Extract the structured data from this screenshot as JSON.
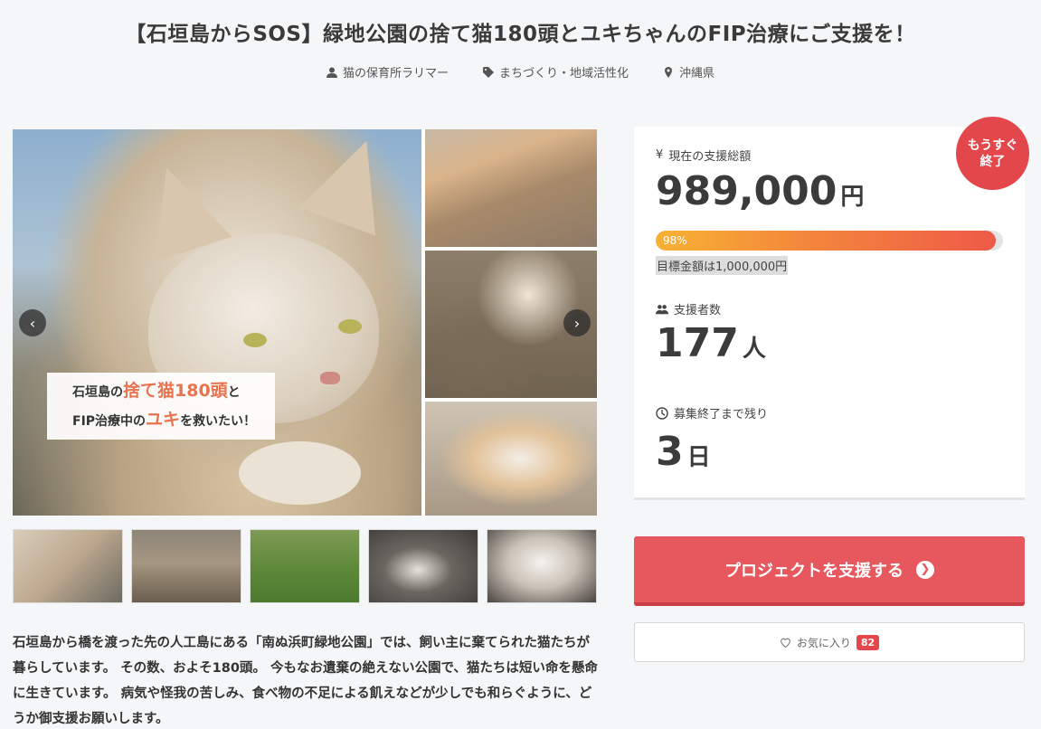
{
  "header": {
    "title": "【石垣島からSOS】緑地公園の捨て猫180頭とユキちゃんのFIP治療にご支援を！",
    "owner": "猫の保育所ラリマー",
    "category": "まちづくり・地域活性化",
    "location": "沖縄県"
  },
  "gallery": {
    "caption_line1_pre": "石垣島の",
    "caption_line1_hl": "捨て猫180頭",
    "caption_line1_post": "と",
    "caption_line2_pre": "FIP治療中の",
    "caption_line2_hl": "ユキ",
    "caption_line2_post": "を救いたい！",
    "thumbnail_count": 5
  },
  "description": "石垣島から橋を渡った先の人工島にある「南ぬ浜町緑地公園」では、飼い主に棄てられた猫たちが暮らしています。 その数、およそ180頭。 今もなお遺棄の絶えない公園で、猫たちは短い命を懸命に生きています。 病気や怪我の苦しみ、食べ物の不足による飢えなどが少しでも和らぐように、どうか御支援お願いします。",
  "stats": {
    "badge_line1": "もうすぐ",
    "badge_line2": "終了",
    "total_label": "現在の支援総額",
    "total_value": "989,000",
    "total_unit": "円",
    "progress_label": "98%",
    "progress_fraction": 0.98,
    "goal_text": "目標金額は1,000,000円",
    "supporters_label": "支援者数",
    "supporters_value": "177",
    "supporters_unit": "人",
    "remaining_label": "募集終了まで残り",
    "remaining_value": "3",
    "remaining_unit": "日"
  },
  "actions": {
    "support_label": "プロジェクトを支援する",
    "favorite_label": "お気に入り",
    "favorite_count": "82"
  },
  "colors": {
    "accent": "#e7585e",
    "badge": "#e4474b",
    "highlight": "#e8734f"
  }
}
